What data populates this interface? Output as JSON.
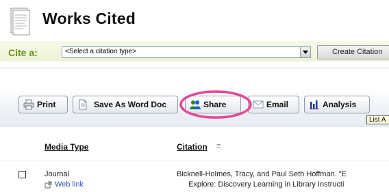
{
  "header": {
    "title": "Works Cited",
    "cite_label": "Cite a:",
    "citation_type_select": "<Select a citation type>",
    "create_button": "Create Citation"
  },
  "toolbar": {
    "print": "Print",
    "save_word": "Save As Word Doc",
    "share": "Share",
    "email": "Email",
    "analysis": "Analysis",
    "tooltip": "List A"
  },
  "table": {
    "columns": [
      "Media Type",
      "Citation"
    ],
    "rows": [
      {
        "media_type": "Journal",
        "web_link": "Web link",
        "citation_line1": "Bicknell-Holmes, Tracy, and Paul Seth Hoffman. \"E",
        "citation_line2": "Explore: Discovery Learning in Library Instructi"
      }
    ]
  },
  "colors": {
    "cite_label": "#6a8f14",
    "link": "#2a55a8",
    "highlight_ring": "#e8479a"
  }
}
